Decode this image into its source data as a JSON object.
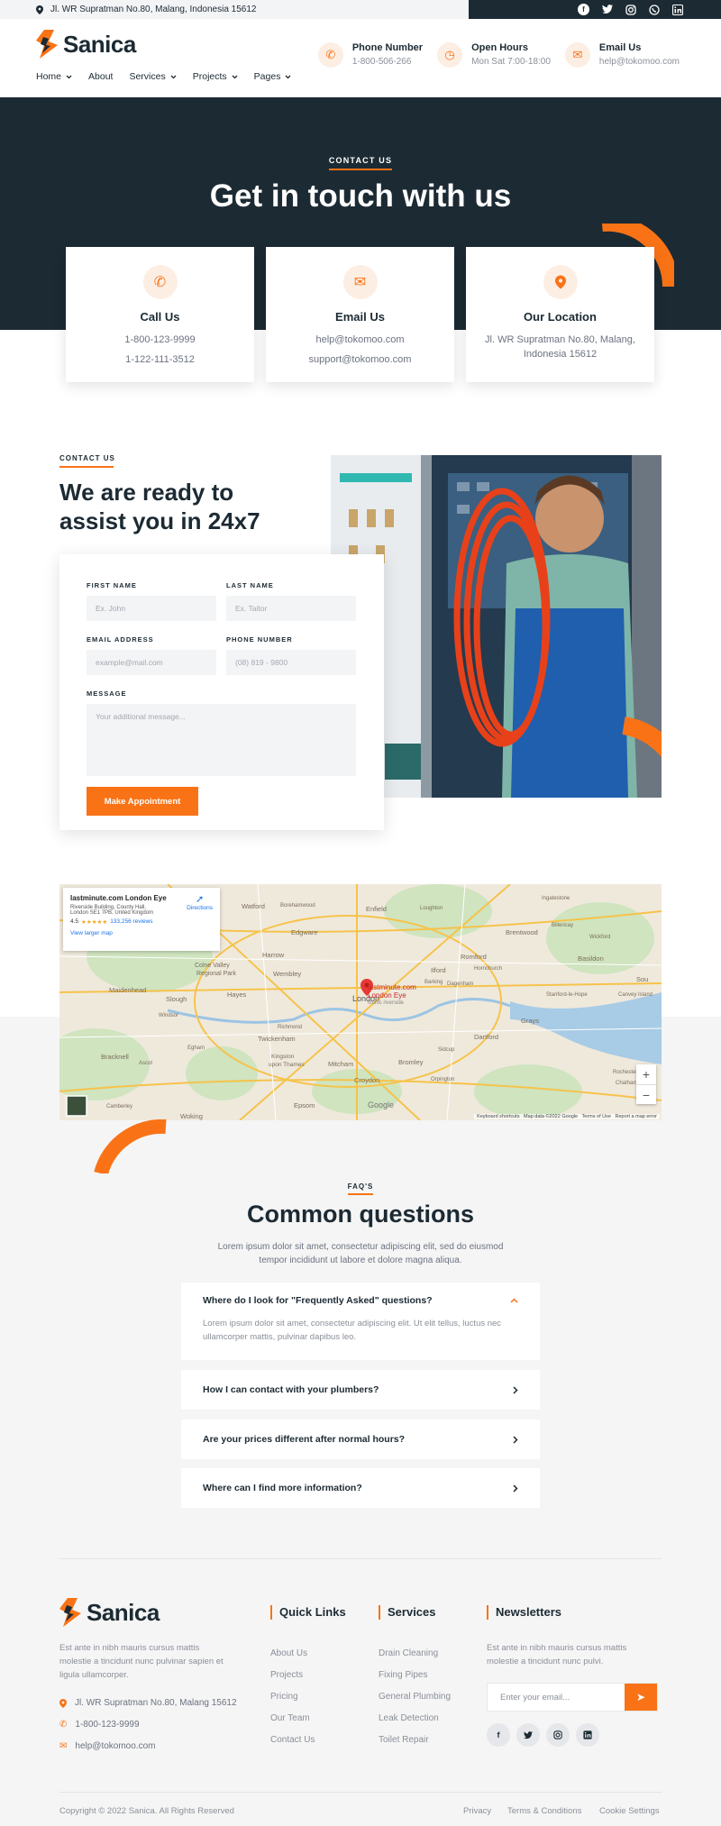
{
  "topbar": {
    "address": "Jl. WR Supratman No.80, Malang, Indonesia 15612",
    "social": [
      "facebook-icon",
      "twitter-icon",
      "instagram-icon",
      "whatsapp-icon",
      "linkedin-icon"
    ]
  },
  "brand": {
    "name": "Sanica",
    "accent": "#f97316",
    "dark": "#1c2a33"
  },
  "nav": [
    {
      "label": "Home",
      "dropdown": true
    },
    {
      "label": "About",
      "dropdown": false
    },
    {
      "label": "Services",
      "dropdown": true
    },
    {
      "label": "Projects",
      "dropdown": true
    },
    {
      "label": "Pages",
      "dropdown": true
    }
  ],
  "header_contacts": [
    {
      "icon": "phone-icon",
      "title": "Phone Number",
      "value": "1-800-506-266"
    },
    {
      "icon": "clock-icon",
      "title": "Open Hours",
      "value": "Mon Sat 7:00-18:00"
    },
    {
      "icon": "mail-icon",
      "title": "Email Us",
      "value": "help@tokomoo.com"
    }
  ],
  "hero": {
    "kicker": "CONTACT US",
    "title": "Get in touch with us"
  },
  "cards": [
    {
      "icon": "phone-icon",
      "title": "Call Us",
      "lines": [
        "1-800-123-9999",
        "1-122-111-3512"
      ]
    },
    {
      "icon": "mail-icon",
      "title": "Email Us",
      "lines": [
        "help@tokomoo.com",
        "support@tokomoo.com"
      ]
    },
    {
      "icon": "location-pin-icon",
      "title": "Our Location",
      "lines": [
        "Jl. WR Supratman No.80, Malang,",
        "Indonesia 15612"
      ]
    }
  ],
  "assist": {
    "kicker": "CONTACT US",
    "title_line1": "We are ready to",
    "title_line2": "assist you in 24x7"
  },
  "form": {
    "first_name": {
      "label": "FIRST NAME",
      "placeholder": "Ex. John"
    },
    "last_name": {
      "label": "LAST NAME",
      "placeholder": "Ex. Taitor"
    },
    "email": {
      "label": "EMAIL ADDRESS",
      "placeholder": "example@mail.com"
    },
    "phone": {
      "label": "PHONE NUMBER",
      "placeholder": "(08) 819 - 9800"
    },
    "message": {
      "label": "MESSAGE",
      "placeholder": "Your additional message..."
    },
    "submit": "Make Appointment"
  },
  "map": {
    "place_name": "lastminute.com London Eye",
    "address_line1": "Riverside Building, County Hall,",
    "address_line2": "London SE1 7PB, United Kingdom",
    "rating": "4.5",
    "stars": "★★★★★",
    "reviews": "133,256 reviews",
    "view_larger": "View larger map",
    "directions": "Directions",
    "pin_label_1": "lastminute.com",
    "pin_label_2": "London Eye",
    "pin_label_3": "Iconic riverside",
    "footer": "Keyboard shortcuts   Map data ©2022 Google   Terms of Use   Report a map error",
    "google": "Google",
    "zoom_in": "+",
    "zoom_out": "−",
    "places": [
      "Watford",
      "Borehamwood",
      "Enfield",
      "Loughton",
      "Ingatestone",
      "South Woodham Ferrers",
      "Brentwood",
      "Billericay",
      "Wickford",
      "Edgware",
      "Harrow",
      "Romford",
      "Hornchurch",
      "Basildon",
      "Colne Valley Regional Park",
      "Wembley",
      "Ilford",
      "Barking",
      "Dagenham",
      "Maidenhead",
      "Slough",
      "Hayes",
      "London",
      "Windsor",
      "Richmond",
      "Twickenham",
      "Kingston upon Thames",
      "Mitcham",
      "Bromley",
      "Dartford",
      "Grays",
      "Southend",
      "Canvey Island",
      "Stanford-le-Hope",
      "Bracknell",
      "Ascot",
      "Egham",
      "Croydon",
      "Sidcup",
      "Orpington",
      "Rochester",
      "Chatham",
      "Camberley",
      "Woking",
      "Epsom",
      "Sou"
    ]
  },
  "faq": {
    "kicker": "FAQ'S",
    "title": "Common questions",
    "desc_line1": "Lorem ipsum dolor sit amet, consectetur adipiscing elit, sed do eiusmod",
    "desc_line2": "tempor incididunt ut labore et dolore magna aliqua.",
    "items": [
      {
        "q": "Where do I look for \"Frequently Asked\" questions?",
        "open": true,
        "a1": "Lorem ipsum dolor sit amet, consectetur adipiscing elit. Ut elit tellus, luctus nec",
        "a2": "ullamcorper mattis, pulvinar dapibus leo."
      },
      {
        "q": "How I can contact with your plumbers?",
        "open": false
      },
      {
        "q": "Are your prices different after normal hours?",
        "open": false
      },
      {
        "q": "Where can I find more information?",
        "open": false
      }
    ]
  },
  "footer": {
    "desc_line1": "Est ante in nibh mauris cursus mattis",
    "desc_line2": "molestie a tincidunt nunc pulvinar sapien et",
    "desc_line3": "ligula ullamcorper.",
    "address": "Jl. WR Supratman No.80, Malang 15612",
    "phone": "1-800-123-9999",
    "email": "help@tokomoo.com",
    "quick_links_title": "Quick Links",
    "quick_links": [
      "About Us",
      "Projects",
      "Pricing",
      "Our Team",
      "Contact Us"
    ],
    "services_title": "Services",
    "services": [
      "Drain Cleaning",
      "Fixing Pipes",
      "General Plumbing",
      "Leak Detection",
      "Toilet Repair"
    ],
    "newsletter_title": "Newsletters",
    "newsletter_desc1": "Est ante in nibh mauris cursus mattis",
    "newsletter_desc2": "molestie a tincidunt nunc pulvi.",
    "newsletter_placeholder": "Enter your email...",
    "copyright": "Copyright © 2022 Sanica. All Rights Reserved",
    "legal": [
      "Privacy",
      "Terms & Conditions",
      "Cookie Settings"
    ]
  }
}
